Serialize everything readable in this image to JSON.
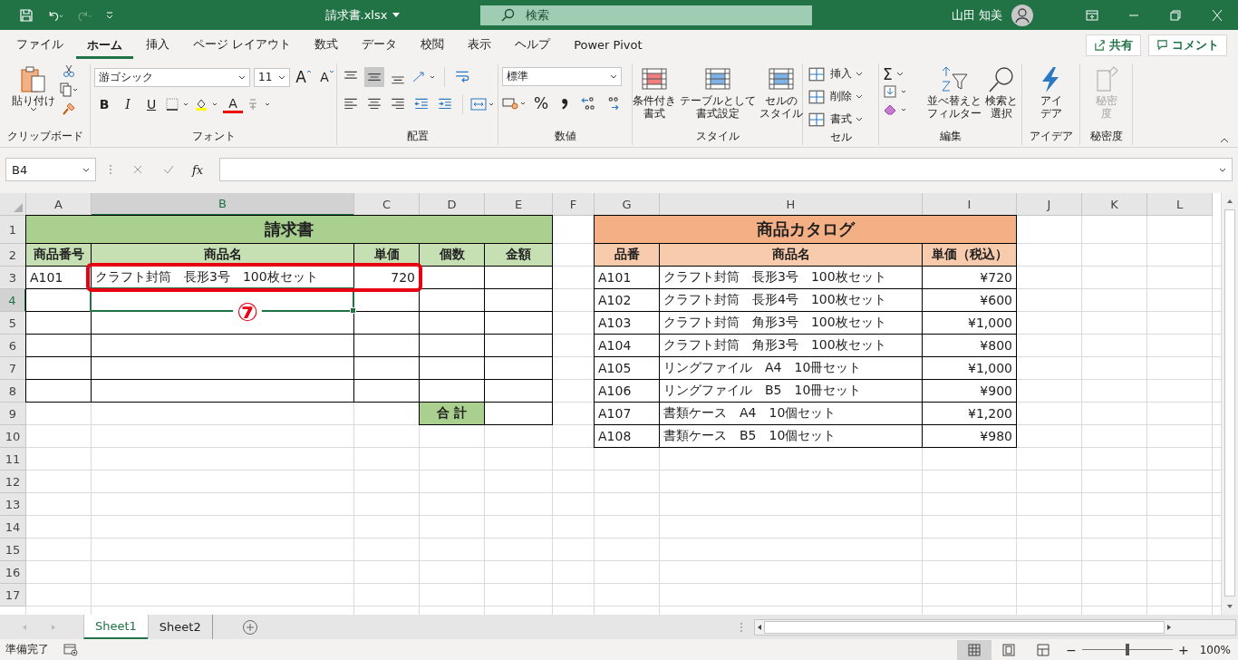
{
  "title_bar": {
    "file_name": "請求書.xlsx",
    "search_placeholder": "検索",
    "user_name": "山田 知美"
  },
  "menu_tabs": [
    {
      "label": "ファイル",
      "selected": false
    },
    {
      "label": "ホーム",
      "selected": true
    },
    {
      "label": "挿入",
      "selected": false
    },
    {
      "label": "ページ レイアウト",
      "selected": false
    },
    {
      "label": "数式",
      "selected": false
    },
    {
      "label": "データ",
      "selected": false
    },
    {
      "label": "校閲",
      "selected": false
    },
    {
      "label": "表示",
      "selected": false
    },
    {
      "label": "ヘルプ",
      "selected": false
    },
    {
      "label": "Power Pivot",
      "selected": false
    }
  ],
  "share_button": "共有",
  "comment_button": "コメント",
  "ribbon": {
    "clipboard": {
      "label": "クリップボード",
      "paste": "貼り付け"
    },
    "font": {
      "label": "フォント",
      "font_name": "游ゴシック",
      "font_size": "11",
      "grow": "A",
      "shrink": "A",
      "bold": "B",
      "italic": "I",
      "underline": "U",
      "font_color": "A"
    },
    "alignment": {
      "label": "配置"
    },
    "number": {
      "label": "数値",
      "format": "標準",
      "percent": "%"
    },
    "styles": {
      "label": "スタイル",
      "buttons": [
        "条件付き書式",
        "テーブルとして書式設定",
        "セルのスタイル"
      ]
    },
    "cells": {
      "label": "セル",
      "buttons": [
        "挿入",
        "削除",
        "書式"
      ]
    },
    "editing": {
      "label": "編集",
      "sum": "Σ",
      "buttons": [
        "並べ替えとフィルター",
        "検索と選択"
      ]
    },
    "ideas": {
      "label": "アイデア",
      "button": "アイデア"
    },
    "sensitivity": {
      "label": "秘密度",
      "button": "秘密度",
      "disabled": true
    }
  },
  "formula_bar": {
    "name_box": "B4",
    "function_label": "fx"
  },
  "columns": [
    {
      "label": "A",
      "selected": false
    },
    {
      "label": "B",
      "selected": true
    },
    {
      "label": "C",
      "selected": false
    },
    {
      "label": "D",
      "selected": false
    },
    {
      "label": "E",
      "selected": false
    },
    {
      "label": "F",
      "selected": false
    },
    {
      "label": "G",
      "selected": false
    },
    {
      "label": "H",
      "selected": false
    },
    {
      "label": "I",
      "selected": false
    },
    {
      "label": "J",
      "selected": false
    },
    {
      "label": "K",
      "selected": false
    },
    {
      "label": "L",
      "selected": false
    }
  ],
  "rows": [
    {
      "label": "1",
      "selected": false
    },
    {
      "label": "2",
      "selected": false
    },
    {
      "label": "3",
      "selected": false
    },
    {
      "label": "4",
      "selected": true
    },
    {
      "label": "5",
      "selected": false
    },
    {
      "label": "6",
      "selected": false
    },
    {
      "label": "7",
      "selected": false
    },
    {
      "label": "8",
      "selected": false
    },
    {
      "label": "9",
      "selected": false
    },
    {
      "label": "10",
      "selected": false
    },
    {
      "label": "11",
      "selected": false
    },
    {
      "label": "12",
      "selected": false
    },
    {
      "label": "13",
      "selected": false
    },
    {
      "label": "14",
      "selected": false
    },
    {
      "label": "15",
      "selected": false
    },
    {
      "label": "16",
      "selected": false
    },
    {
      "label": "17",
      "selected": false
    }
  ],
  "invoice": {
    "title": "請求書",
    "headers": [
      "商品番号",
      "商品名",
      "単価",
      "個数",
      "金額"
    ],
    "rows": [
      [
        "A101",
        "クラフト封筒　長形3号　100枚セット",
        "720"
      ]
    ],
    "total_label": "合 計"
  },
  "catalog": {
    "title": "商品カタログ",
    "headers": [
      "品番",
      "商品名",
      "単価（税込）"
    ],
    "rows": [
      {
        "code": "A101",
        "name": "クラフト封筒　長形3号　100枚セット",
        "price": "¥720"
      },
      {
        "code": "A102",
        "name": "クラフト封筒　長形4号　100枚セット",
        "price": "¥600"
      },
      {
        "code": "A103",
        "name": "クラフト封筒　角形3号　100枚セット",
        "price": "¥1,000"
      },
      {
        "code": "A104",
        "name": "クラフト封筒　角形3号　100枚セット",
        "price": "¥800"
      },
      {
        "code": "A105",
        "name": "リングファイル　A4　10冊セット",
        "price": "¥1,000"
      },
      {
        "code": "A106",
        "name": "リングファイル　B5　10冊セット",
        "price": "¥900"
      },
      {
        "code": "A107",
        "name": "書類ケース　A4　10個セット",
        "price": "¥1,200"
      },
      {
        "code": "A108",
        "name": "書類ケース　B5　10個セット",
        "price": "¥980"
      }
    ]
  },
  "annotation": {
    "marker": "⑦"
  },
  "sheet_tabs": [
    {
      "label": "Sheet1",
      "selected": true
    },
    {
      "label": "Sheet2",
      "selected": false
    }
  ],
  "status_bar": {
    "status": "準備完了",
    "zoom_out": "−",
    "zoom_in": "+",
    "zoom_level": "100%",
    "level": 0.5
  }
}
